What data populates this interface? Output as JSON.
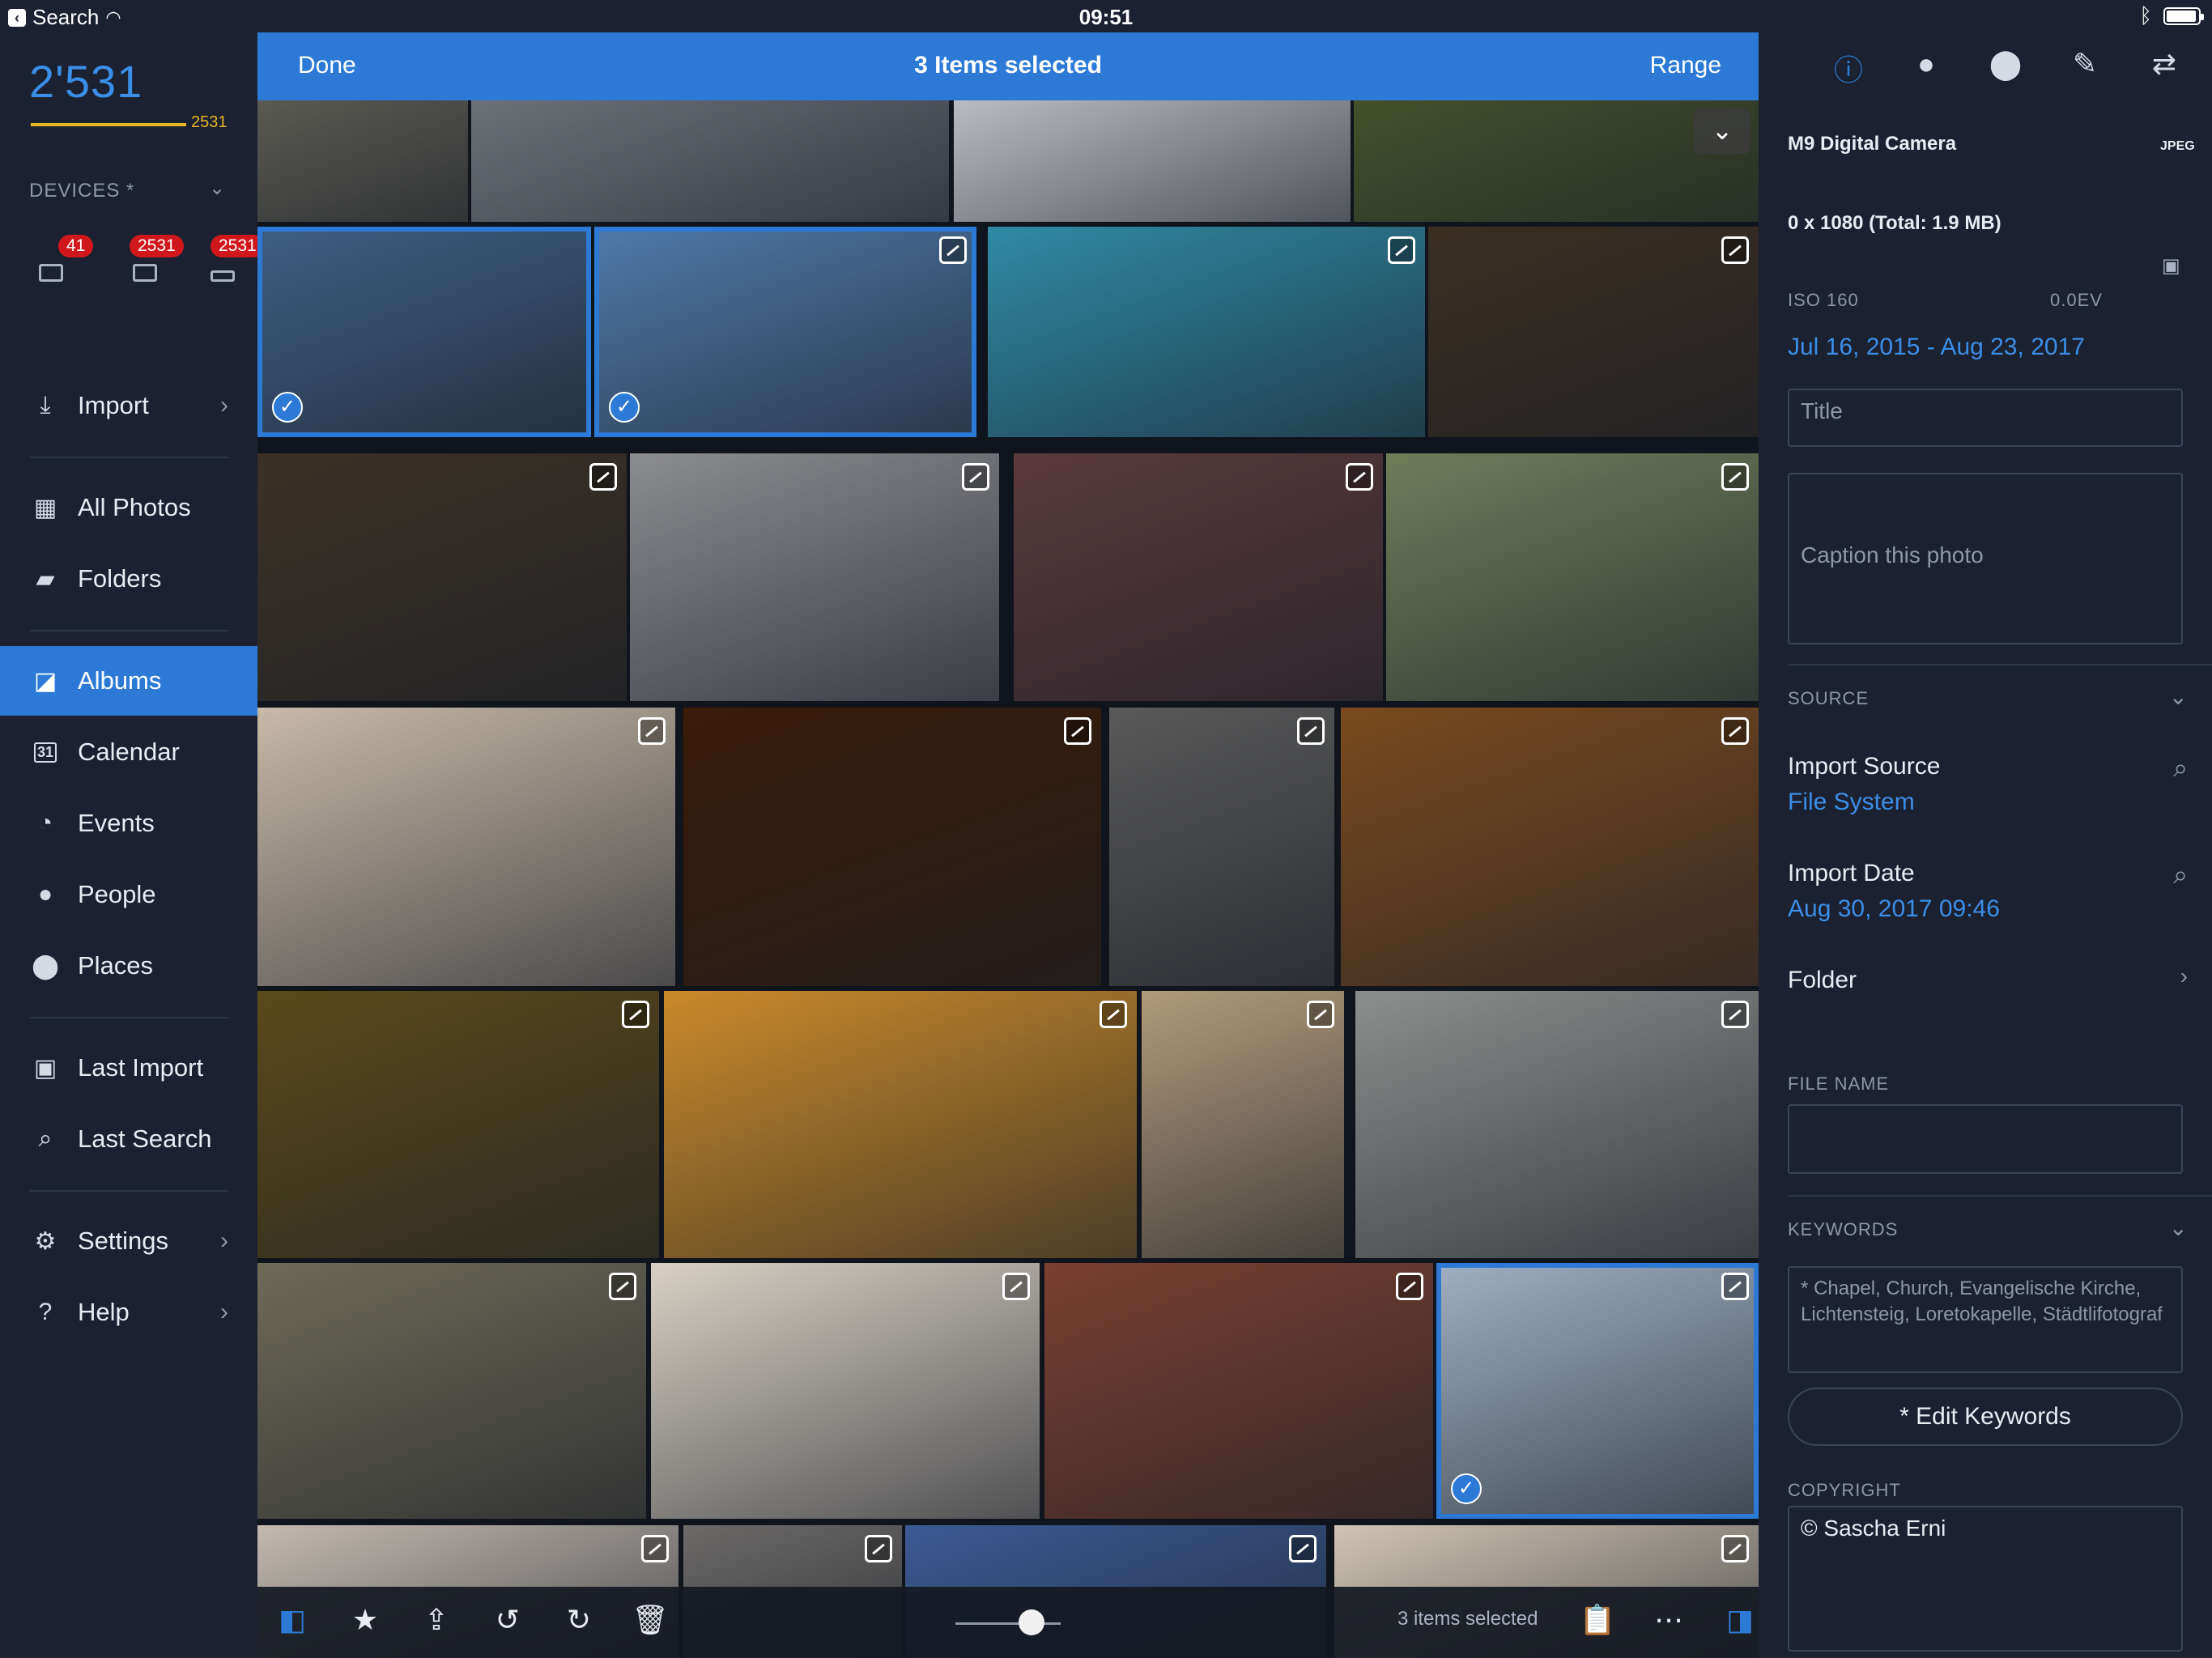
{
  "status": {
    "back_label": "Search",
    "time": "09:51"
  },
  "sidebar": {
    "count": "2'531",
    "count_small": "2531",
    "devices_label": "DEVICES *",
    "device_badges": [
      "41",
      "2531",
      "2531"
    ],
    "items": [
      {
        "label": "Import",
        "icon": "import-icon"
      },
      {
        "label": "All Photos",
        "icon": "grid-icon"
      },
      {
        "label": "Folders",
        "icon": "folder-icon"
      },
      {
        "label": "Albums",
        "icon": "album-icon"
      },
      {
        "label": "Calendar",
        "icon": "calendar-icon"
      },
      {
        "label": "Events",
        "icon": "clock-icon"
      },
      {
        "label": "People",
        "icon": "person-icon"
      },
      {
        "label": "Places",
        "icon": "pin-icon"
      },
      {
        "label": "Last Import",
        "icon": "last-import-icon"
      },
      {
        "label": "Last Search",
        "icon": "search-icon"
      },
      {
        "label": "Settings",
        "icon": "gear-icon"
      },
      {
        "label": "Help",
        "icon": "help-icon"
      }
    ],
    "calendar_day": "31"
  },
  "topbar": {
    "done": "Done",
    "title": "3 Items selected",
    "range": "Range"
  },
  "photos": {
    "colors": [
      "#6b6a5e",
      "#7b7f86",
      "#d8dbe0",
      "#4c5a2c",
      "#3e5f84",
      "#4f7aaa",
      "#2f8aa6",
      "#3a2e22",
      "#3b3126",
      "#8b8c90",
      "#5a3a3c",
      "#6f7d5a",
      "#c7b9a8",
      "#3a1c08",
      "#595959",
      "#7a4a1e",
      "#5a4a1a",
      "#c98a2a",
      "#b19a7a",
      "#8a8e8c",
      "#6e6a58",
      "#d8d0c4",
      "#7a4030",
      "#9fb0c2",
      "#c2b9b0",
      "#6c6a68",
      "#3c5a94",
      "#d0c4b4"
    ]
  },
  "toolbar": {
    "selected_text": "3 items selected"
  },
  "panel": {
    "camera": "M9 Digital Camera",
    "format": "JPEG",
    "dimensions": "0 x 1080 (Total: 1.9 MB)",
    "iso": "ISO 160",
    "ev": "0.0EV",
    "date_range": "Jul 16, 2015 - Aug 23, 2017",
    "title_placeholder": "Title",
    "caption_placeholder": "Caption this photo",
    "source_label": "SOURCE",
    "import_source_label": "Import Source",
    "import_source_value": "File System",
    "import_date_label": "Import Date",
    "import_date_value": "Aug 30, 2017 09:46",
    "folder_label": "Folder",
    "file_name_label": "FILE NAME",
    "keywords_label": "KEYWORDS",
    "keywords_value": "* Chapel, Church, Evangelische Kirche, Lichtensteig, Loretokapelle, Städtlifotograf",
    "edit_keywords": "* Edit Keywords",
    "copyright_label": "COPYRIGHT",
    "copyright_value": "© Sascha Erni"
  },
  "accent": "#2d7ad6"
}
